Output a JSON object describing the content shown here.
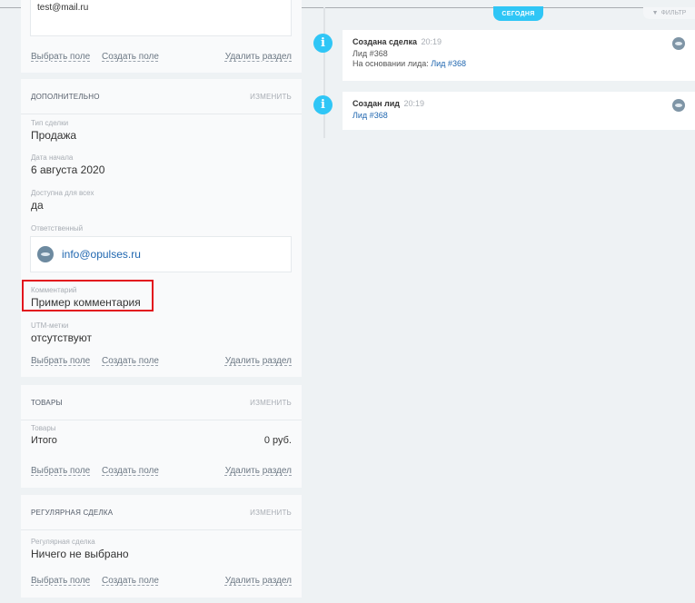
{
  "contact": {
    "email": "test@mail.ru"
  },
  "common_links": {
    "select_field": "Выбрать поле",
    "create_field": "Создать поле",
    "delete_section": "Удалить раздел"
  },
  "additional": {
    "title": "ДОПОЛНИТЕЛЬНО",
    "edit": "изменить",
    "deal_type_label": "Тип сделки",
    "deal_type_value": "Продажа",
    "start_date_label": "Дата начала",
    "start_date_value": "6 августа 2020",
    "available_label": "Доступна для всех",
    "available_value": "да",
    "responsible_label": "Ответственный",
    "responsible_value": "info@opulses.ru",
    "comment_label": "Комментарий",
    "comment_value": "Пример комментария",
    "utm_label": "UTM-метки",
    "utm_value": "отсутствуют"
  },
  "goods": {
    "title": "ТОВАРЫ",
    "edit": "изменить",
    "label": "Товары",
    "total_label": "Итого",
    "total_value": "0 руб."
  },
  "regular": {
    "title": "РЕГУЛЯРНАЯ СДЕЛКА",
    "edit": "изменить",
    "label": "Регулярная сделка",
    "value": "Ничего не выбрано"
  },
  "timeline": {
    "today_badge": "сегодня",
    "filter": "фильтр",
    "events": [
      {
        "title": "Создана сделка",
        "time": "20:19",
        "line1": "Лид #368",
        "line2_prefix": "На основании лида:",
        "line2_link": "Лид #368"
      },
      {
        "title": "Создан лид",
        "time": "20:19",
        "link": "Лид #368"
      }
    ]
  }
}
